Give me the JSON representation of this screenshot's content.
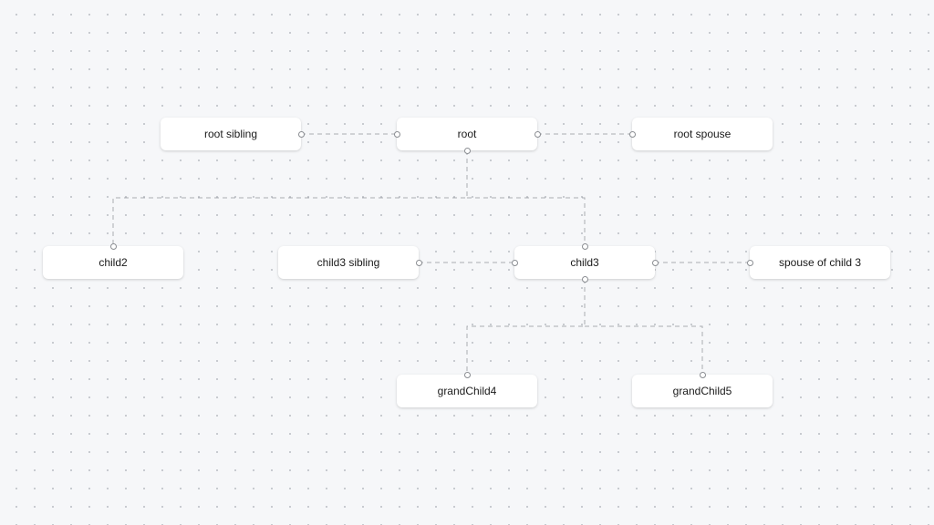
{
  "diagram": {
    "nodes": [
      {
        "id": "root-sibling",
        "label": "root sibling"
      },
      {
        "id": "root",
        "label": "root"
      },
      {
        "id": "root-spouse",
        "label": "root spouse"
      },
      {
        "id": "child2",
        "label": "child2"
      },
      {
        "id": "child3-sibling",
        "label": "child3 sibling"
      },
      {
        "id": "child3",
        "label": "child3"
      },
      {
        "id": "spouse-of-child3",
        "label": "spouse of child 3"
      },
      {
        "id": "grandchild4",
        "label": "grandChild4"
      },
      {
        "id": "grandchild5",
        "label": "grandChild5"
      }
    ],
    "edges": [
      {
        "from": "root-sibling",
        "to": "root",
        "type": "sibling"
      },
      {
        "from": "root",
        "to": "root-spouse",
        "type": "spouse"
      },
      {
        "from": "root",
        "to": "child2",
        "type": "child"
      },
      {
        "from": "root",
        "to": "child3",
        "type": "child"
      },
      {
        "from": "child3-sibling",
        "to": "child3",
        "type": "sibling"
      },
      {
        "from": "child3",
        "to": "spouse-of-child3",
        "type": "spouse"
      },
      {
        "from": "child3",
        "to": "grandchild4",
        "type": "child"
      },
      {
        "from": "child3",
        "to": "grandchild5",
        "type": "child"
      }
    ]
  }
}
